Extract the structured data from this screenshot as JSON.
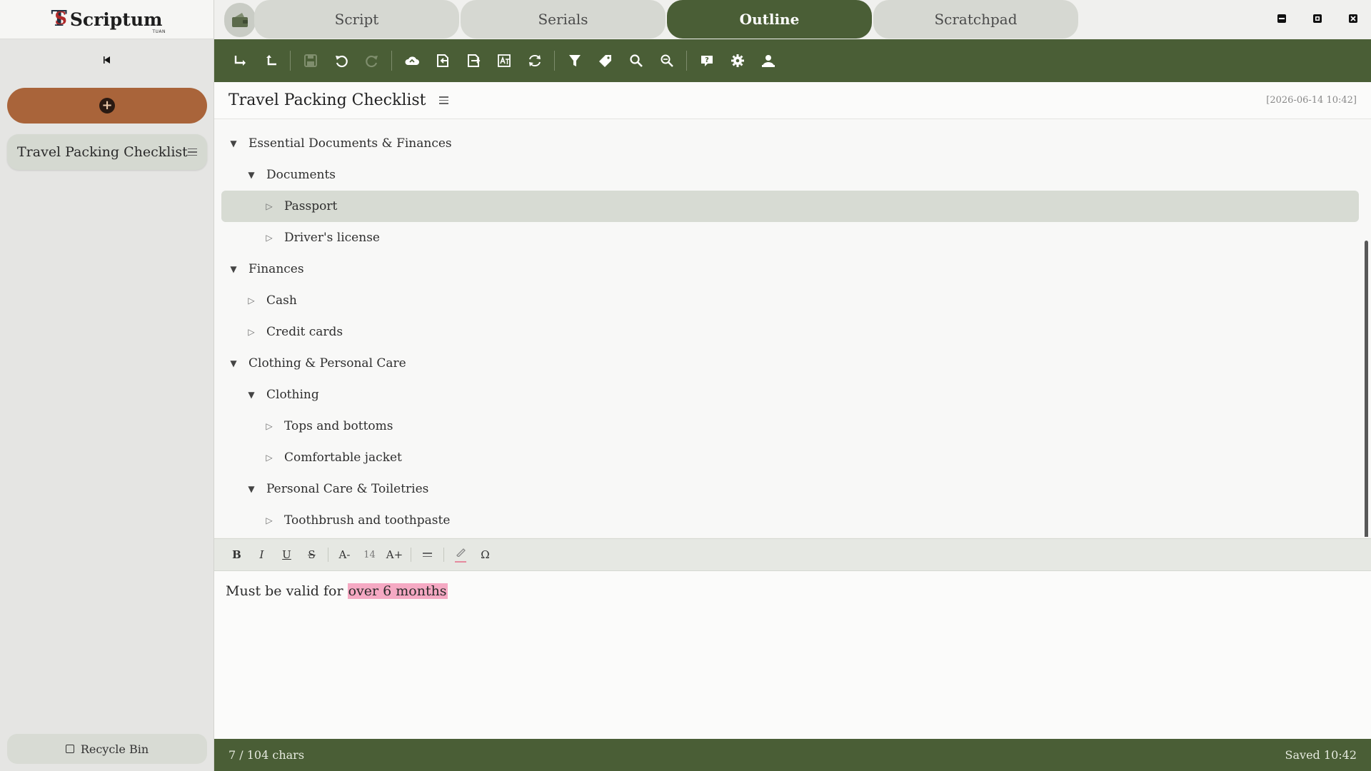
{
  "app": {
    "logo_text": "Scriptum",
    "logo_mark": "T",
    "logo_sub": "TUAN"
  },
  "sidebar": {
    "collapse_icon": "triangle-left-icon",
    "add_icon": "plus-circle-icon",
    "documents": [
      {
        "label": "Travel Packing Checklist",
        "menu_icon": "hamburger-icon"
      }
    ],
    "recycle_label": "Recycle Bin"
  },
  "tabs": [
    {
      "label": "Script",
      "active": false
    },
    {
      "label": "Serials",
      "active": false
    },
    {
      "label": "Outline",
      "active": true
    },
    {
      "label": "Scratchpad",
      "active": false
    }
  ],
  "toolbar": {
    "icons": [
      "indent-icon",
      "outdent-icon",
      "save-icon",
      "undo-icon",
      "redo-icon",
      "cloud-sync-icon",
      "import-icon",
      "export-icon",
      "translate-icon",
      "sync-icon",
      "filter-icon",
      "tag-icon",
      "search-icon",
      "find-replace-icon",
      "help-icon",
      "settings-icon",
      "account-icon"
    ]
  },
  "document": {
    "title": "Travel Packing Checklist",
    "timestamp": "[2026-06-14 10:42]"
  },
  "outline": [
    {
      "label": "Essential Documents & Finances",
      "level": 0,
      "expanded": true
    },
    {
      "label": "Documents",
      "level": 1,
      "expanded": true
    },
    {
      "label": "Passport",
      "level": 2,
      "expanded": false,
      "selected": true
    },
    {
      "label": "Driver's license",
      "level": 2,
      "expanded": false
    },
    {
      "label": "Finances",
      "level": 0,
      "expanded": true
    },
    {
      "label": "Cash",
      "level": 1,
      "expanded": false
    },
    {
      "label": "Credit cards",
      "level": 1,
      "expanded": false
    },
    {
      "label": "Clothing & Personal Care",
      "level": 0,
      "expanded": true
    },
    {
      "label": "Clothing",
      "level": 1,
      "expanded": true
    },
    {
      "label": "Tops and bottoms",
      "level": 2,
      "expanded": false
    },
    {
      "label": "Comfortable jacket",
      "level": 2,
      "expanded": false
    },
    {
      "label": "Personal Care & Toiletries",
      "level": 1,
      "expanded": true
    },
    {
      "label": "Toothbrush and toothpaste",
      "level": 2,
      "expanded": false
    }
  ],
  "format_bar": {
    "bold": "B",
    "italic": "I",
    "underline": "U",
    "strike": "S",
    "font_down": "A-",
    "font_size": "14",
    "font_up": "A+",
    "align_icon": "align-icon",
    "highlight_icon": "highlighter-icon",
    "special_char": "Ω"
  },
  "editor": {
    "text_before": "Must be valid for ",
    "text_highlighted": "over 6 months",
    "highlight_color": "#f5a9c3"
  },
  "status": {
    "chars": "7 / 104 chars",
    "saved": "Saved 10:42"
  },
  "colors": {
    "accent": "#4a5e36",
    "add_button": "#a9643a"
  }
}
